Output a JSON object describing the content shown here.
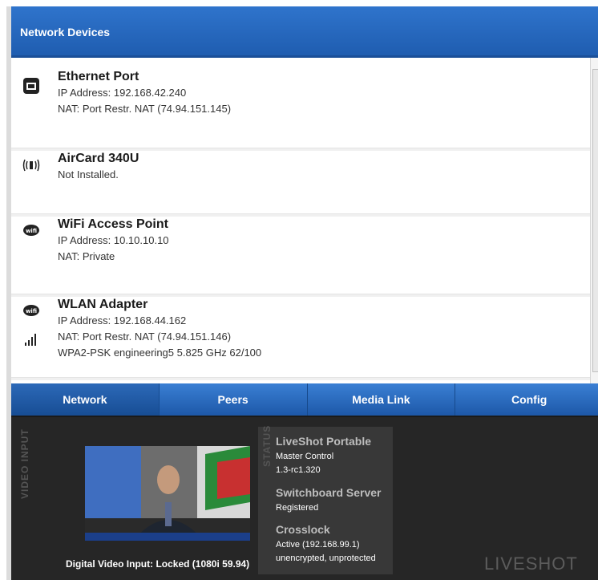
{
  "header": {
    "title": "Network Devices"
  },
  "devices": [
    {
      "icon": "ethernet-icon",
      "title": "Ethernet Port",
      "lines": [
        "IP Address: 192.168.42.240",
        "NAT: Port Restr. NAT (74.94.151.145)"
      ]
    },
    {
      "icon": "aircard-icon",
      "title": "AirCard 340U",
      "lines": [
        "Not Installed."
      ]
    },
    {
      "icon": "wifi-icon",
      "title": "WiFi Access Point",
      "lines": [
        "IP Address: 10.10.10.10",
        "NAT: Private"
      ]
    },
    {
      "icon": "wifi-icon",
      "title": "WLAN Adapter",
      "lines": [
        "IP Address: 192.168.44.162",
        "NAT: Port Restr. NAT (74.94.151.146)",
        "WPA2-PSK engineering5 5.825 GHz 62/100"
      ]
    }
  ],
  "tabs": [
    {
      "label": "Network",
      "active": true
    },
    {
      "label": "Peers"
    },
    {
      "label": "Media Link"
    },
    {
      "label": "Config"
    }
  ],
  "video_input": {
    "section_label": "VIDEO INPUT",
    "caption": "Digital Video Input: Locked (1080i 59.94)"
  },
  "status": {
    "section_label": "STATUS",
    "device_name": "LiveShot Portable",
    "device_role": "Master Control",
    "device_version": "1.3-rc1.320",
    "switchboard_label": "Switchboard Server",
    "switchboard_state": "Registered",
    "crosslock_label": "Crosslock",
    "crosslock_state": "Active (192.168.99.1)",
    "crosslock_security": "unencrypted, unprotected"
  },
  "brand": "LIVESHOT",
  "colors": {
    "accent": "#1f5db0",
    "panel": "#262626"
  }
}
